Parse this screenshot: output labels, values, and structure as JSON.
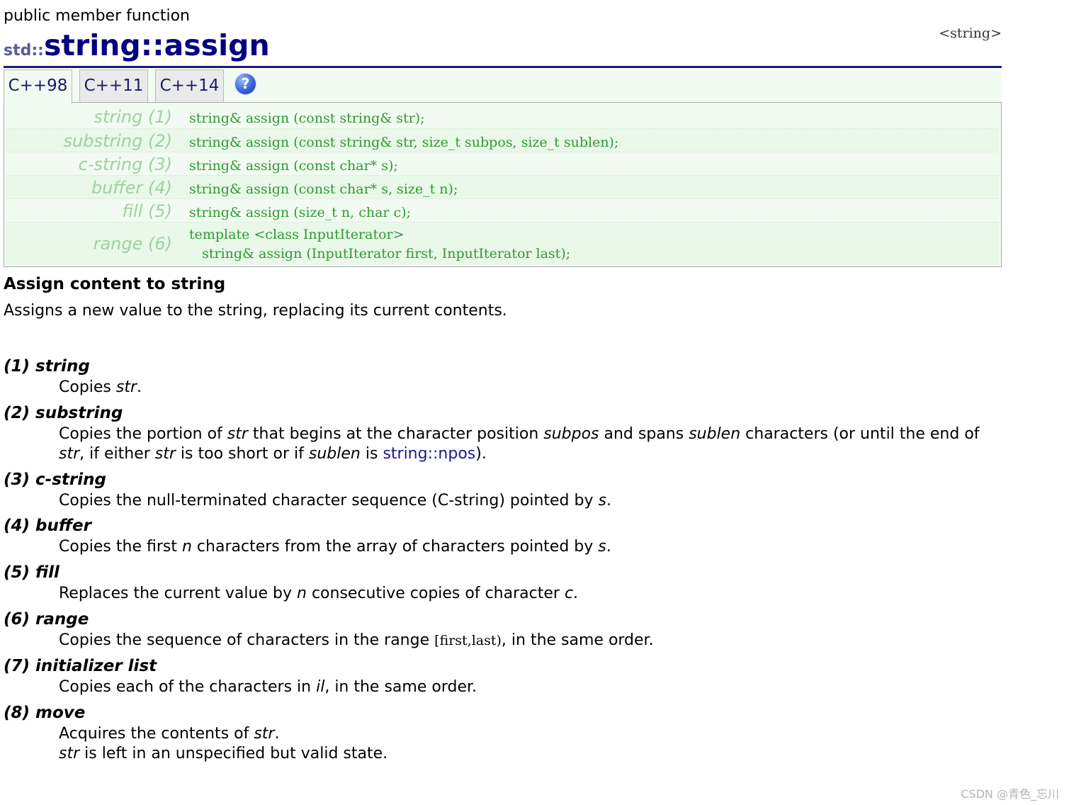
{
  "header": {
    "kind": "public member function",
    "namespace": "std::",
    "class_name": "string",
    "separator": "::",
    "function_name": "assign",
    "library_header": "<string>"
  },
  "tabs": [
    {
      "label": "C++98",
      "active": true
    },
    {
      "label": "C++11",
      "active": false
    },
    {
      "label": "C++14",
      "active": false
    }
  ],
  "help_icon": "question-mark-icon",
  "prototypes": [
    {
      "label": "string (1)",
      "code": "string& assign (const string& str);"
    },
    {
      "label": "substring (2)",
      "code": "string& assign (const string& str, size_t subpos, size_t sublen);"
    },
    {
      "label": "c-string (3)",
      "code": "string& assign (const char* s);"
    },
    {
      "label": "buffer (4)",
      "code": "string& assign (const char* s, size_t n);"
    },
    {
      "label": "fill (5)",
      "code": "string& assign (size_t n, char c);"
    },
    {
      "label": "range (6)",
      "code_line1": "template <class InputIterator>",
      "code_line2": "   string& assign (InputIterator first, InputIterator last);"
    }
  ],
  "summary": {
    "title": "Assign content to string",
    "description": "Assigns a new value to the string, replacing its current contents."
  },
  "definitions": {
    "d1": {
      "term": "(1) string",
      "t1": "Copies ",
      "i1": "str",
      "t2": "."
    },
    "d2": {
      "term": "(2) substring",
      "t1": "Copies the portion of ",
      "i1": "str",
      "t2": " that begins at the character position ",
      "i2": "subpos",
      "t3": " and spans ",
      "i3": "sublen",
      "t4": " characters (or until the end of ",
      "i4": "str",
      "t5": ", if either ",
      "i5": "str",
      "t6": " is too short or if ",
      "i6": "sublen",
      "t7": " is ",
      "link": "string::npos",
      "t8": ")."
    },
    "d3": {
      "term": "(3) c-string",
      "t1": "Copies the null-terminated character sequence (C-string) pointed by ",
      "i1": "s",
      "t2": "."
    },
    "d4": {
      "term": "(4) buffer",
      "t1": "Copies the first ",
      "i1": "n",
      "t2": " characters from the array of characters pointed by ",
      "i2": "s",
      "t3": "."
    },
    "d5": {
      "term": "(5) fill",
      "t1": "Replaces the current value by ",
      "i1": "n",
      "t2": " consecutive copies of character ",
      "i2": "c",
      "t3": "."
    },
    "d6": {
      "term": "(6) range",
      "t1": "Copies the sequence of characters in the range ",
      "code": "[first,last)",
      "t2": ", in the same order."
    },
    "d7": {
      "term": "(7) initializer list",
      "t1": "Copies each of the characters in ",
      "i1": "il",
      "t2": ", in the same order."
    },
    "d8": {
      "term": "(8) move",
      "t1": "Acquires the contents of ",
      "i1": "str",
      "t2": ".",
      "i2": "str",
      "t3": " is left in an unspecified but valid state."
    }
  },
  "watermark": "CSDN @青色_忘川"
}
